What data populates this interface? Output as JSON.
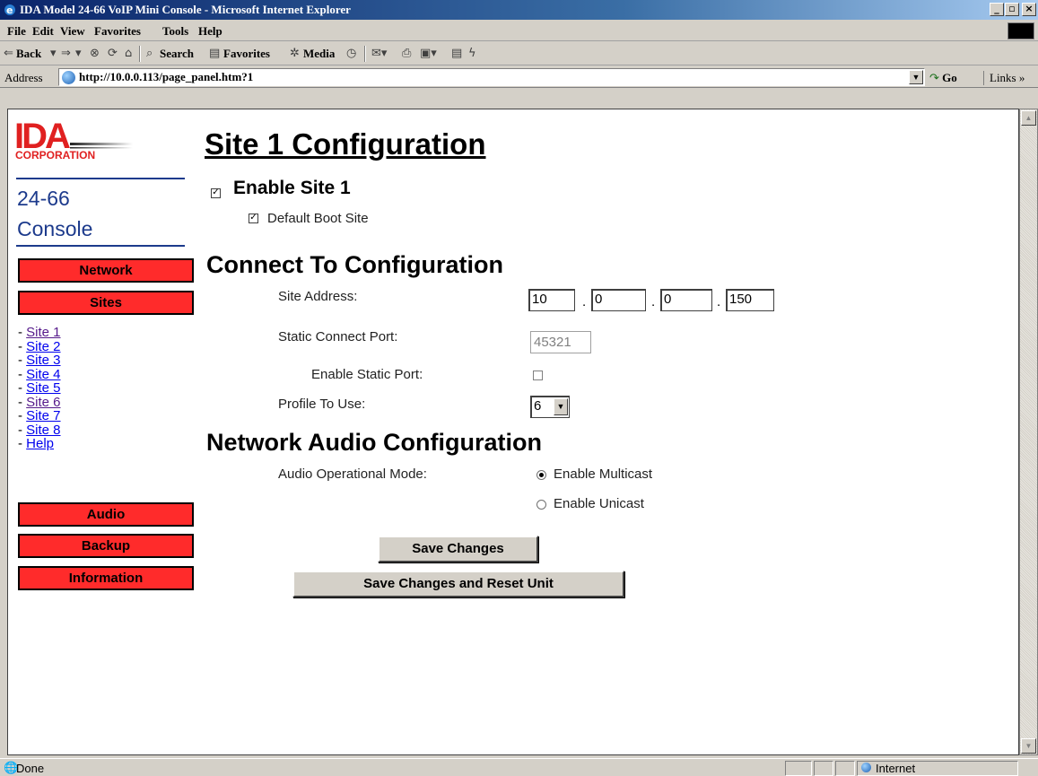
{
  "window": {
    "title": "IDA Model 24-66 VoIP Mini Console - Microsoft Internet Explorer"
  },
  "menu": [
    "File",
    "Edit",
    "View",
    "Favorites",
    "Tools",
    "Help"
  ],
  "toolbar": {
    "back": "Back",
    "search": "Search",
    "favorites": "Favorites",
    "media": "Media"
  },
  "address": {
    "label": "Address",
    "url": "http://10.0.0.113/page_panel.htm?1",
    "go": "Go",
    "links": "Links"
  },
  "sidebar": {
    "logo_main": "IDA",
    "logo_sub": "CORPORATION",
    "model_line1": "24-66",
    "model_line2": "Console",
    "buttons": {
      "network": "Network",
      "sites": "Sites",
      "audio": "Audio",
      "backup": "Backup",
      "information": "Information"
    },
    "site_links": [
      {
        "label": "Site 1",
        "visited": true
      },
      {
        "label": "Site 2",
        "visited": false
      },
      {
        "label": "Site 3",
        "visited": false
      },
      {
        "label": "Site 4",
        "visited": false
      },
      {
        "label": "Site 5",
        "visited": false
      },
      {
        "label": "Site 6",
        "visited": true
      },
      {
        "label": "Site 7",
        "visited": false
      },
      {
        "label": "Site 8",
        "visited": false
      },
      {
        "label": "Help",
        "visited": false
      }
    ],
    "link_prefix": "-"
  },
  "main": {
    "title": "Site 1 Configuration",
    "enable_site_label": "Enable Site 1",
    "enable_site_checked": true,
    "default_boot_label": "Default Boot Site",
    "default_boot_checked": true,
    "connect_heading": "Connect To Configuration",
    "site_address_label": "Site Address:",
    "ip": [
      "10",
      "0",
      "0",
      "150"
    ],
    "ip_sep": ".",
    "static_port_label": "Static Connect Port:",
    "static_port_value": "45321",
    "enable_static_label": "Enable Static Port:",
    "enable_static_checked": false,
    "profile_label": "Profile To Use:",
    "profile_value": "6",
    "audio_heading": "Network Audio Configuration",
    "audio_mode_label": "Audio Operational Mode:",
    "multicast_label": "Enable Multicast",
    "unicast_label": "Enable Unicast",
    "selected_mode": "multicast",
    "save_button": "Save Changes",
    "save_reset_button": "Save Changes and Reset Unit"
  },
  "status": {
    "text": "Done",
    "zone": "Internet"
  },
  "colors": {
    "nav_button": "#ff2b2b",
    "model_text": "#1c3a8c",
    "logo_red": "#e02020"
  }
}
